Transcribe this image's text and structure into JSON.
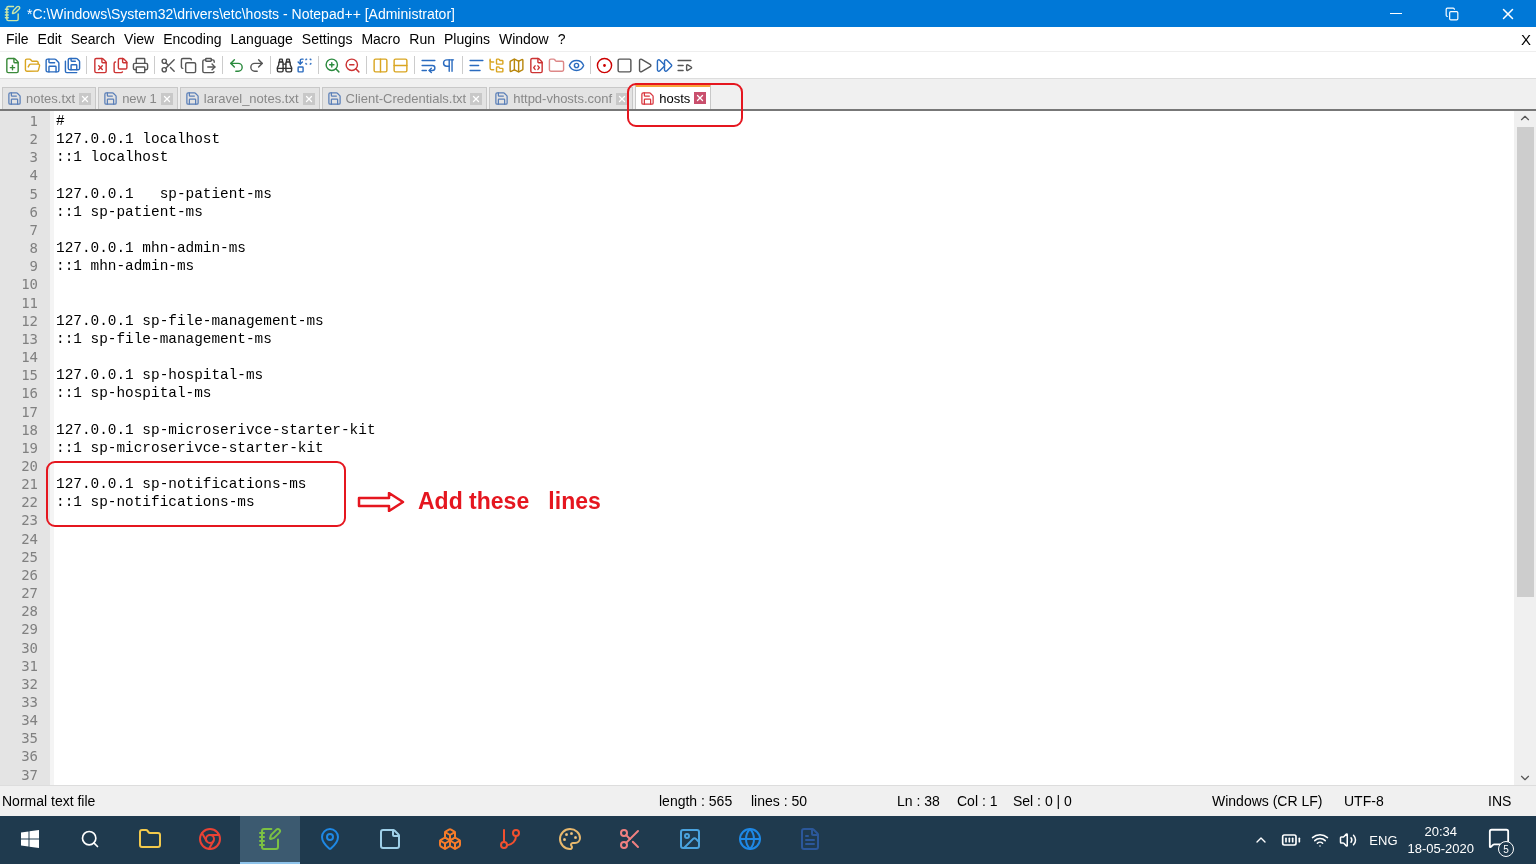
{
  "window": {
    "title": "*C:\\Windows\\System32\\drivers\\etc\\hosts - Notepad++ [Administrator]",
    "close_document": "X"
  },
  "menu": [
    "File",
    "Edit",
    "Search",
    "View",
    "Encoding",
    "Language",
    "Settings",
    "Macro",
    "Run",
    "Plugins",
    "Window",
    "?"
  ],
  "tabs": [
    {
      "label": "notes.txt",
      "selected": false,
      "modified": false
    },
    {
      "label": "new 1",
      "selected": false,
      "modified": false
    },
    {
      "label": "laravel_notes.txt",
      "selected": false,
      "modified": false
    },
    {
      "label": "Client-Credentials.txt",
      "selected": false,
      "modified": false
    },
    {
      "label": "httpd-vhosts.conf",
      "selected": false,
      "modified": false
    },
    {
      "label": "hosts",
      "selected": true,
      "modified": true
    }
  ],
  "editor": {
    "lines": [
      {
        "number": "1",
        "text": "#"
      },
      {
        "number": "2",
        "text": "127.0.0.1 localhost"
      },
      {
        "number": "3",
        "text": "::1 localhost"
      },
      {
        "number": "4"
      },
      {
        "number": "5",
        "text": "127.0.0.1   sp-patient-ms"
      },
      {
        "number": "6",
        "text": "::1 sp-patient-ms"
      },
      {
        "number": "7"
      },
      {
        "number": "8",
        "text": "127.0.0.1 mhn-admin-ms"
      },
      {
        "number": "9",
        "text": "::1 mhn-admin-ms"
      },
      {
        "number": "10"
      },
      {
        "number": "11"
      },
      {
        "number": "12",
        "text": "127.0.0.1 sp-file-management-ms"
      },
      {
        "number": "13",
        "text": "::1 sp-file-management-ms"
      },
      {
        "number": "14"
      },
      {
        "number": "15",
        "text": "127.0.0.1 sp-hospital-ms"
      },
      {
        "number": "16",
        "text": "::1 sp-hospital-ms"
      },
      {
        "number": "17"
      },
      {
        "number": "18",
        "text": "127.0.0.1 sp-microserivce-starter-kit"
      },
      {
        "number": "19",
        "text": "::1 sp-microserivce-starter-kit"
      },
      {
        "number": "20"
      },
      {
        "number": "21",
        "text": "127.0.0.1 sp-notifications-ms"
      },
      {
        "number": "22",
        "text": "::1 sp-notifications-ms"
      },
      {
        "number": "23"
      },
      {
        "number": "24"
      },
      {
        "number": "25"
      },
      {
        "number": "26"
      },
      {
        "number": "27"
      },
      {
        "number": "28"
      },
      {
        "number": "29"
      },
      {
        "number": "30"
      },
      {
        "number": "31"
      },
      {
        "number": "32"
      },
      {
        "number": "33"
      },
      {
        "number": "34"
      },
      {
        "number": "35"
      },
      {
        "number": "36"
      },
      {
        "number": "37"
      }
    ],
    "annotation": {
      "text": "Add these   lines"
    }
  },
  "status_bar": {
    "file_type": "Normal text file",
    "length": "length : 565",
    "lines": "lines : 50",
    "ln": "Ln : 38",
    "col": "Col : 1",
    "sel": "Sel : 0 | 0",
    "eol": "Windows (CR LF)",
    "encoding": "UTF-8",
    "mode": "INS"
  },
  "taskbar": {
    "apps": [
      {
        "kind": "explorer",
        "selected": false
      },
      {
        "kind": "chrome",
        "selected": false
      },
      {
        "kind": "notepadpp",
        "selected": true
      },
      {
        "kind": "maps",
        "selected": false
      },
      {
        "kind": "notes",
        "selected": false
      },
      {
        "kind": "xampp",
        "selected": false
      },
      {
        "kind": "git",
        "selected": false
      },
      {
        "kind": "paint",
        "selected": false
      },
      {
        "kind": "snip",
        "selected": false
      },
      {
        "kind": "photos",
        "selected": false
      },
      {
        "kind": "edge",
        "selected": false
      },
      {
        "kind": "word",
        "selected": false
      }
    ],
    "language": "ENG",
    "time": "20:34",
    "date": "18-05-2020",
    "notifications": "5"
  }
}
